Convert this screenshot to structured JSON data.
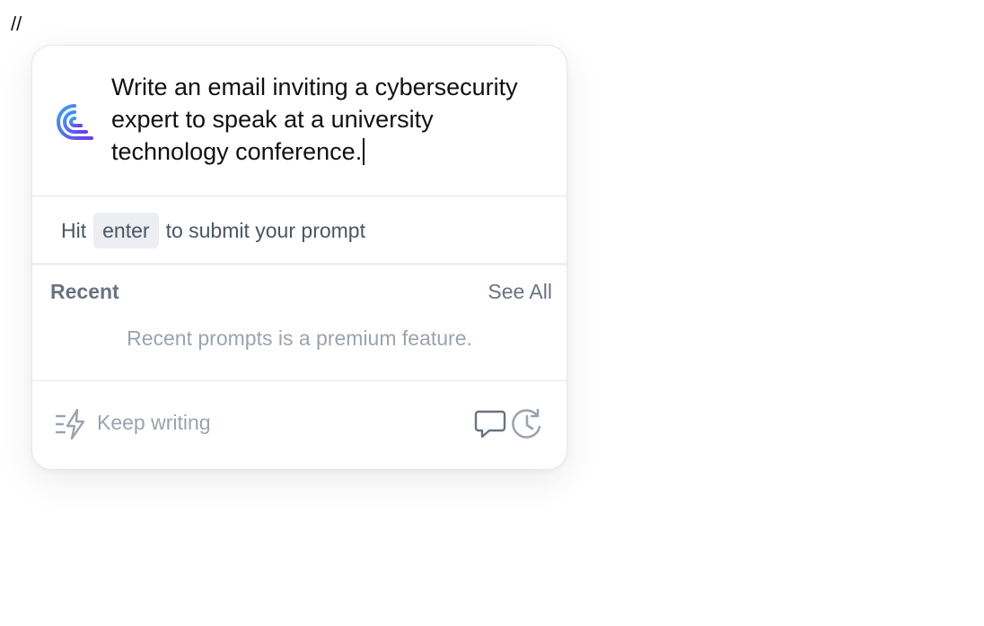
{
  "trigger": {
    "text": "//"
  },
  "prompt": {
    "text": "Write an email inviting a cybersecurity expert to speak at a university technology conference."
  },
  "hint": {
    "prefix": "Hit",
    "key": "enter",
    "suffix": "to submit your prompt"
  },
  "recent": {
    "title": "Recent",
    "see_all": "See All",
    "empty_message": "Recent prompts is a premium feature."
  },
  "footer": {
    "keep_writing": "Keep writing"
  },
  "icons": {
    "logo": "ai-logo-icon",
    "keep_writing": "lightning-icon",
    "chat": "chat-bubble-icon",
    "history": "history-icon"
  },
  "colors": {
    "logo_gradient_start": "#2f6fe8",
    "logo_gradient_end": "#6a3df0",
    "muted_text": "#9ca3af",
    "secondary_text": "#6b7280"
  }
}
